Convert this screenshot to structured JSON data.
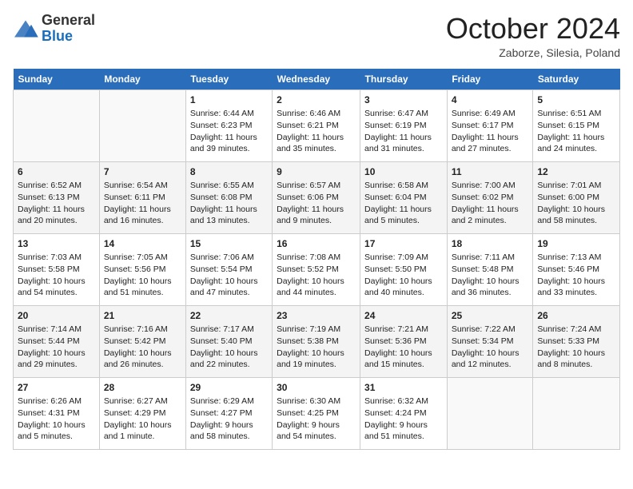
{
  "header": {
    "logo_line1": "General",
    "logo_line2": "Blue",
    "month_title": "October 2024",
    "subtitle": "Zaborze, Silesia, Poland"
  },
  "days_of_week": [
    "Sunday",
    "Monday",
    "Tuesday",
    "Wednesday",
    "Thursday",
    "Friday",
    "Saturday"
  ],
  "weeks": [
    [
      {
        "day": "",
        "info": ""
      },
      {
        "day": "",
        "info": ""
      },
      {
        "day": "1",
        "info": "Sunrise: 6:44 AM\nSunset: 6:23 PM\nDaylight: 11 hours and 39 minutes."
      },
      {
        "day": "2",
        "info": "Sunrise: 6:46 AM\nSunset: 6:21 PM\nDaylight: 11 hours and 35 minutes."
      },
      {
        "day": "3",
        "info": "Sunrise: 6:47 AM\nSunset: 6:19 PM\nDaylight: 11 hours and 31 minutes."
      },
      {
        "day": "4",
        "info": "Sunrise: 6:49 AM\nSunset: 6:17 PM\nDaylight: 11 hours and 27 minutes."
      },
      {
        "day": "5",
        "info": "Sunrise: 6:51 AM\nSunset: 6:15 PM\nDaylight: 11 hours and 24 minutes."
      }
    ],
    [
      {
        "day": "6",
        "info": "Sunrise: 6:52 AM\nSunset: 6:13 PM\nDaylight: 11 hours and 20 minutes."
      },
      {
        "day": "7",
        "info": "Sunrise: 6:54 AM\nSunset: 6:11 PM\nDaylight: 11 hours and 16 minutes."
      },
      {
        "day": "8",
        "info": "Sunrise: 6:55 AM\nSunset: 6:08 PM\nDaylight: 11 hours and 13 minutes."
      },
      {
        "day": "9",
        "info": "Sunrise: 6:57 AM\nSunset: 6:06 PM\nDaylight: 11 hours and 9 minutes."
      },
      {
        "day": "10",
        "info": "Sunrise: 6:58 AM\nSunset: 6:04 PM\nDaylight: 11 hours and 5 minutes."
      },
      {
        "day": "11",
        "info": "Sunrise: 7:00 AM\nSunset: 6:02 PM\nDaylight: 11 hours and 2 minutes."
      },
      {
        "day": "12",
        "info": "Sunrise: 7:01 AM\nSunset: 6:00 PM\nDaylight: 10 hours and 58 minutes."
      }
    ],
    [
      {
        "day": "13",
        "info": "Sunrise: 7:03 AM\nSunset: 5:58 PM\nDaylight: 10 hours and 54 minutes."
      },
      {
        "day": "14",
        "info": "Sunrise: 7:05 AM\nSunset: 5:56 PM\nDaylight: 10 hours and 51 minutes."
      },
      {
        "day": "15",
        "info": "Sunrise: 7:06 AM\nSunset: 5:54 PM\nDaylight: 10 hours and 47 minutes."
      },
      {
        "day": "16",
        "info": "Sunrise: 7:08 AM\nSunset: 5:52 PM\nDaylight: 10 hours and 44 minutes."
      },
      {
        "day": "17",
        "info": "Sunrise: 7:09 AM\nSunset: 5:50 PM\nDaylight: 10 hours and 40 minutes."
      },
      {
        "day": "18",
        "info": "Sunrise: 7:11 AM\nSunset: 5:48 PM\nDaylight: 10 hours and 36 minutes."
      },
      {
        "day": "19",
        "info": "Sunrise: 7:13 AM\nSunset: 5:46 PM\nDaylight: 10 hours and 33 minutes."
      }
    ],
    [
      {
        "day": "20",
        "info": "Sunrise: 7:14 AM\nSunset: 5:44 PM\nDaylight: 10 hours and 29 minutes."
      },
      {
        "day": "21",
        "info": "Sunrise: 7:16 AM\nSunset: 5:42 PM\nDaylight: 10 hours and 26 minutes."
      },
      {
        "day": "22",
        "info": "Sunrise: 7:17 AM\nSunset: 5:40 PM\nDaylight: 10 hours and 22 minutes."
      },
      {
        "day": "23",
        "info": "Sunrise: 7:19 AM\nSunset: 5:38 PM\nDaylight: 10 hours and 19 minutes."
      },
      {
        "day": "24",
        "info": "Sunrise: 7:21 AM\nSunset: 5:36 PM\nDaylight: 10 hours and 15 minutes."
      },
      {
        "day": "25",
        "info": "Sunrise: 7:22 AM\nSunset: 5:34 PM\nDaylight: 10 hours and 12 minutes."
      },
      {
        "day": "26",
        "info": "Sunrise: 7:24 AM\nSunset: 5:33 PM\nDaylight: 10 hours and 8 minutes."
      }
    ],
    [
      {
        "day": "27",
        "info": "Sunrise: 6:26 AM\nSunset: 4:31 PM\nDaylight: 10 hours and 5 minutes."
      },
      {
        "day": "28",
        "info": "Sunrise: 6:27 AM\nSunset: 4:29 PM\nDaylight: 10 hours and 1 minute."
      },
      {
        "day": "29",
        "info": "Sunrise: 6:29 AM\nSunset: 4:27 PM\nDaylight: 9 hours and 58 minutes."
      },
      {
        "day": "30",
        "info": "Sunrise: 6:30 AM\nSunset: 4:25 PM\nDaylight: 9 hours and 54 minutes."
      },
      {
        "day": "31",
        "info": "Sunrise: 6:32 AM\nSunset: 4:24 PM\nDaylight: 9 hours and 51 minutes."
      },
      {
        "day": "",
        "info": ""
      },
      {
        "day": "",
        "info": ""
      }
    ]
  ]
}
